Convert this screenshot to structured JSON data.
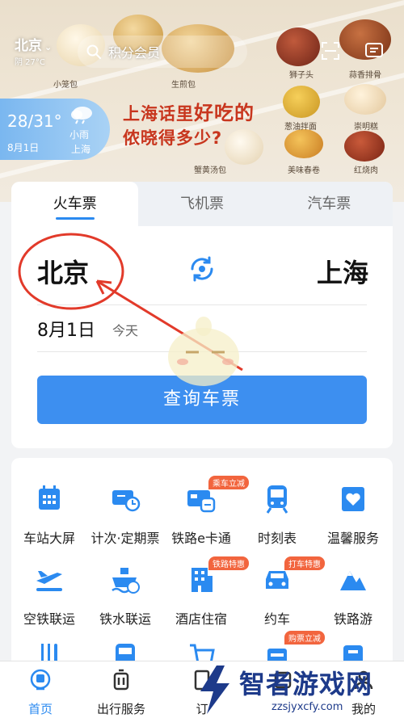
{
  "header": {
    "city": "北京",
    "weather_short": "阴 27°C",
    "search_placeholder": "积分会员"
  },
  "banner": {
    "food_labels": [
      "小笼包",
      "生煎包",
      "狮子头",
      "蒜香排骨",
      "葱油拌面",
      "崇明糕",
      "蟹黄汤包",
      "美味春卷",
      "红烧肉"
    ],
    "promo_line1_a": "上海话里",
    "promo_line1_b": "好吃的",
    "promo_line2": "侬晓得多少?"
  },
  "weather_card": {
    "temp": "28/31°",
    "date": "8月1日",
    "condition": "小雨",
    "city": "上海"
  },
  "booking": {
    "tabs": [
      {
        "label": "火车票",
        "active": true
      },
      {
        "label": "飞机票",
        "active": false
      },
      {
        "label": "汽车票",
        "active": false
      }
    ],
    "from_city": "北京",
    "to_city": "上海",
    "date": "8月1日",
    "date_note": "今天",
    "query_label": "查询车票"
  },
  "services": [
    {
      "label": "车站大屏",
      "icon": "calendar-icon",
      "badge": ""
    },
    {
      "label": "计次·定期票",
      "icon": "ticket-clock-icon",
      "badge": ""
    },
    {
      "label": "铁路e卡通",
      "icon": "card-train-icon",
      "badge": "乘车立减"
    },
    {
      "label": "时刻表",
      "icon": "train-icon",
      "badge": ""
    },
    {
      "label": "温馨服务",
      "icon": "heart-icon",
      "badge": ""
    },
    {
      "label": "空铁联运",
      "icon": "plane-train-icon",
      "badge": ""
    },
    {
      "label": "铁水联运",
      "icon": "ship-icon",
      "badge": ""
    },
    {
      "label": "酒店住宿",
      "icon": "hotel-icon",
      "badge": "铁路特惠"
    },
    {
      "label": "约车",
      "icon": "car-icon",
      "badge": "打车特惠"
    },
    {
      "label": "铁路游",
      "icon": "mountain-icon",
      "badge": ""
    },
    {
      "label": "",
      "icon": "fork-knife-icon",
      "badge": ""
    },
    {
      "label": "",
      "icon": "bus-icon",
      "badge": ""
    },
    {
      "label": "",
      "icon": "cart-icon",
      "badge": ""
    },
    {
      "label": "",
      "icon": "shop-icon",
      "badge": "购票立减"
    },
    {
      "label": "",
      "icon": "shield-icon",
      "badge": ""
    }
  ],
  "bottom_nav": [
    {
      "label": "首页",
      "icon": "home-train-icon",
      "active": true
    },
    {
      "label": "出行服务",
      "icon": "luggage-icon",
      "active": false
    },
    {
      "label": "订",
      "icon": "order-icon",
      "active": false
    },
    {
      "label": "",
      "icon": "other-icon",
      "active": false
    },
    {
      "label": "我的",
      "icon": "user-icon",
      "active": false
    }
  ],
  "watermark": {
    "title": "智者游戏网",
    "url": "zzsjyxcfy.com"
  },
  "colors": {
    "primary": "#3d8ff0",
    "accent_red": "#e23a2a",
    "badge": "#f2653e",
    "promo": "#c8361e"
  }
}
